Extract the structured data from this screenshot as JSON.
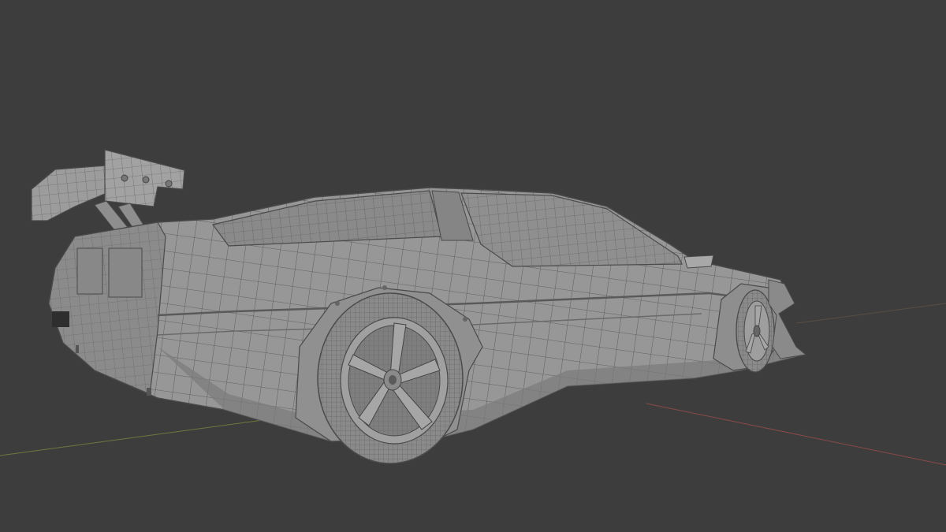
{
  "app": {
    "name": "3D viewport",
    "view": "perspective",
    "background_color": "#3d3d3d"
  },
  "scene": {
    "object": "car-wireframe-model",
    "shading": "solid-with-wireframe",
    "axis_colors": {
      "x_axis": "#8a4a4a",
      "y_axis": "#6b7a3f"
    },
    "model_colors": {
      "body_fill": "#9a9a9a",
      "body_shadow": "#7e7e7e",
      "wire": "#4a4a4a",
      "tire": "#8c8c8c",
      "rim": "#a4a4a4"
    }
  }
}
